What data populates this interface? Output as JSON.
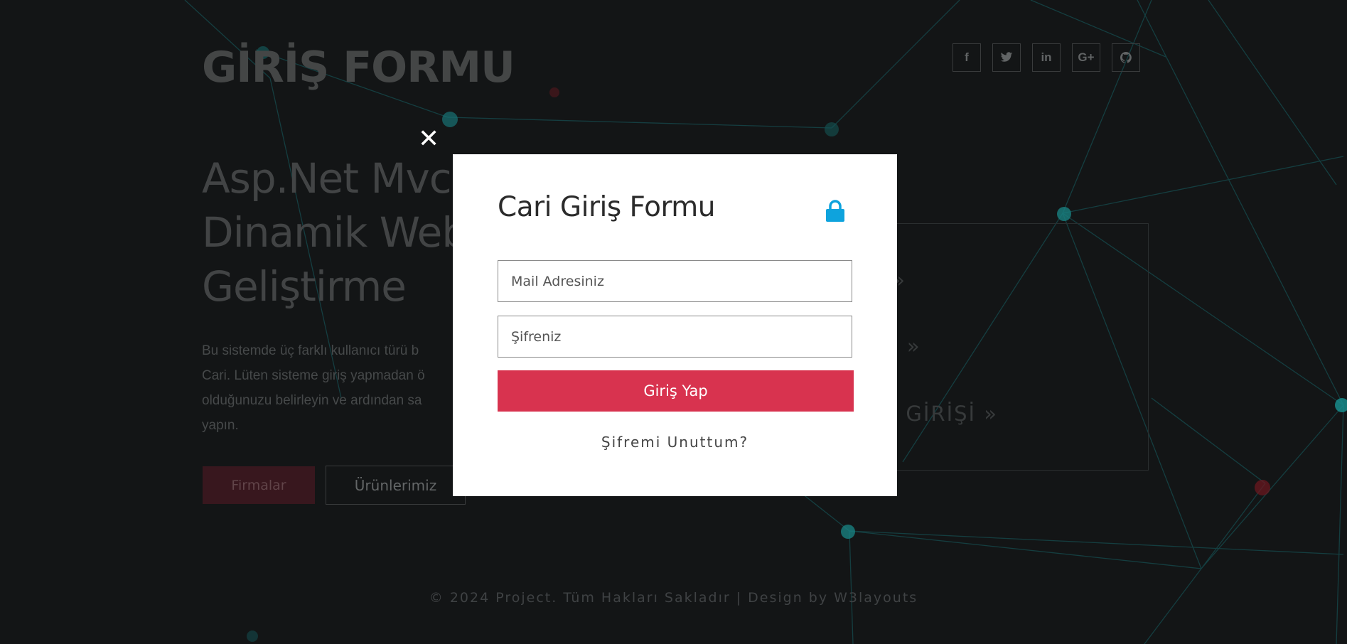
{
  "header": {
    "site_title": "GİRİŞ FORMU",
    "social": [
      {
        "icon": "facebook-icon",
        "glyph": "f"
      },
      {
        "icon": "twitter-icon",
        "glyph": "t"
      },
      {
        "icon": "linkedin-icon",
        "glyph": "in"
      },
      {
        "icon": "google-plus-icon",
        "glyph": "G+"
      },
      {
        "icon": "github-icon",
        "glyph": "gh"
      }
    ]
  },
  "hero": {
    "heading_line1": "Asp.Net Mvc",
    "heading_line2": "Dinamik Web",
    "heading_line3": "Geliştirme",
    "desc_line1": "Bu sistemde üç farklı kullanıcı türü b",
    "desc_line2": "Cari. Lüten sisteme giriş yapmadan ö",
    "desc_line3": "olduğunuzu belirleyin ve ardından sa",
    "desc_line4": "yapın.",
    "btn_firmalar": "Firmalar",
    "btn_urunler": "Ürünlerimiz"
  },
  "login_panel": {
    "item1": "OL  »",
    "item2": "RİŞİ  »",
    "item3": "NEL  GİRİŞİ  »"
  },
  "footer": {
    "text": "© 2024 Project. Tüm Hakları Sakladır | Design by W3layouts"
  },
  "modal": {
    "close_glyph": "✕",
    "title": "Cari Giriş Formu",
    "email_placeholder": "Mail Adresiniz",
    "password_placeholder": "Şifreniz",
    "submit_label": "Giriş Yap",
    "forgot_label": "Şifremi Unuttum?",
    "accent_color": "#d8334f",
    "lock_color": "#0ea3dd"
  }
}
